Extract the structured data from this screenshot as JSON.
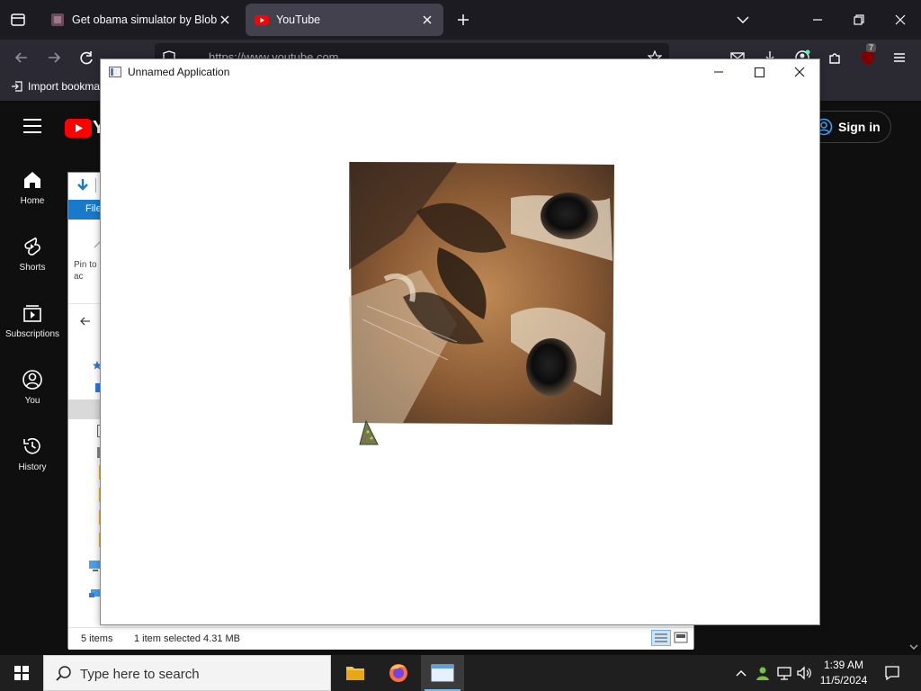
{
  "browser": {
    "tabs": [
      {
        "title": "Get obama simulator by Blob",
        "active": false
      },
      {
        "title": "YouTube",
        "active": true
      }
    ],
    "url": "https://www.youtube.com",
    "bookmark_import": "Import bookma",
    "extension_badge": "7"
  },
  "youtube": {
    "logo_text": "Y",
    "sign_in": "Sign in",
    "nav": [
      {
        "label": "Home",
        "icon": "home-icon"
      },
      {
        "label": "Shorts",
        "icon": "shorts-icon"
      },
      {
        "label": "Subscriptions",
        "icon": "subscriptions-icon"
      },
      {
        "label": "You",
        "icon": "you-icon"
      },
      {
        "label": "History",
        "icon": "history-icon"
      }
    ]
  },
  "explorer": {
    "ribbon_file": "File",
    "pin_label": "Pin to ac",
    "status_items": "5 items",
    "status_selected": "1 item selected  4.31 MB"
  },
  "app_window": {
    "title": "Unnamed Application",
    "content_image": "cat-face-image"
  },
  "taskbar": {
    "search_placeholder": "Type here to search",
    "time": "1:39 AM",
    "date": "11/5/2024"
  },
  "colors": {
    "youtube_red": "#ff0000",
    "explorer_ribbon": "#1979ca",
    "taskbar_accent": "#76b9ed"
  }
}
